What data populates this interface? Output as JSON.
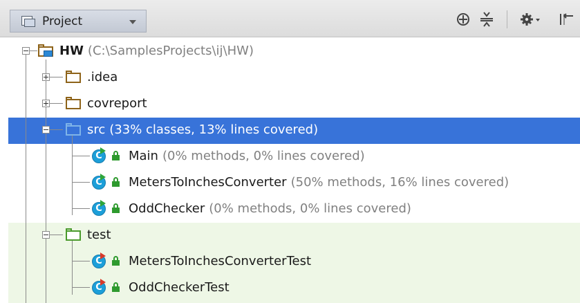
{
  "toolbar": {
    "view_label": "Project",
    "icons": [
      "locate-icon",
      "collapse-all-icon",
      "settings-gear-icon",
      "hide-panel-icon"
    ]
  },
  "tree": {
    "project": {
      "name": "HW",
      "hint": "(C:\\SamplesProjects\\ij\\HW)"
    },
    "idea": {
      "name": ".idea"
    },
    "covreport": {
      "name": "covreport"
    },
    "src": {
      "name": "src",
      "hint": "(33% classes, 13% lines covered)"
    },
    "classes": [
      {
        "name": "Main",
        "hint": "(0% methods, 0% lines covered)"
      },
      {
        "name": "MetersToInchesConverter",
        "hint": "(50% methods, 16% lines covered)"
      },
      {
        "name": "OddChecker",
        "hint": "(0% methods, 0% lines covered)"
      }
    ],
    "test": {
      "name": "test"
    },
    "tests": [
      {
        "name": "MetersToInchesConverterTest"
      },
      {
        "name": "OddCheckerTest"
      }
    ]
  },
  "colors": {
    "selection": "#3873d9",
    "test_background": "#eef7e6",
    "hint_text": "#808080",
    "class_icon": "#1c9fd9",
    "folder": "#8e6319",
    "test_folder": "#4a9a2c"
  }
}
